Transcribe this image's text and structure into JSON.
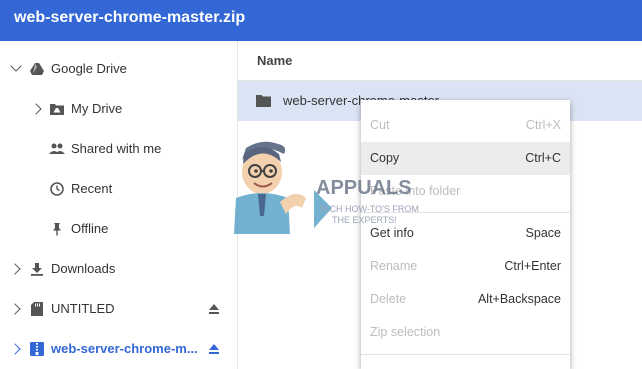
{
  "window": {
    "title": "web-server-chrome-master.zip"
  },
  "sidebar": {
    "items": [
      {
        "label": "Google Drive"
      },
      {
        "label": "My Drive"
      },
      {
        "label": "Shared with me"
      },
      {
        "label": "Recent"
      },
      {
        "label": "Offline"
      },
      {
        "label": "Downloads"
      },
      {
        "label": "UNTITLED"
      },
      {
        "label": "web-server-chrome-m..."
      }
    ]
  },
  "file_list": {
    "column_header": "Name",
    "rows": [
      {
        "name": "web-server-chrome-master"
      }
    ]
  },
  "context_menu": {
    "items": [
      {
        "label": "Cut",
        "shortcut": "Ctrl+X"
      },
      {
        "label": "Copy",
        "shortcut": "Ctrl+C"
      },
      {
        "label": "Paste into folder",
        "shortcut": ""
      },
      {
        "label": "Get info",
        "shortcut": "Space"
      },
      {
        "label": "Rename",
        "shortcut": "Ctrl+Enter"
      },
      {
        "label": "Delete",
        "shortcut": "Alt+Backspace"
      },
      {
        "label": "Zip selection",
        "shortcut": ""
      }
    ]
  },
  "watermark": {
    "brand": "APPUALS",
    "tagline_1": "TECH HOW-TO'S FROM",
    "tagline_2": "THE EXPERTS!"
  },
  "colors": {
    "titlebar": "#3367d6",
    "selection": "#dbe4f5",
    "accent_blue": "#3367d6"
  }
}
